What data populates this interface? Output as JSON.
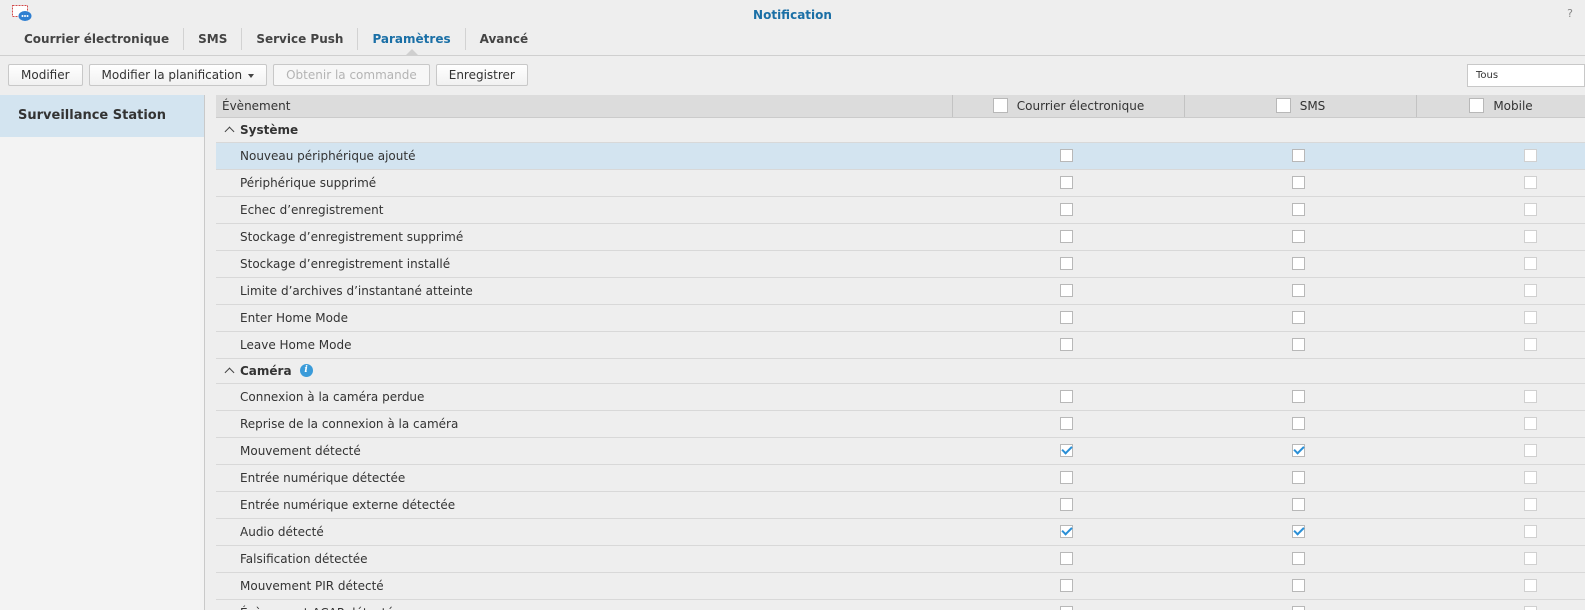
{
  "window": {
    "title": "Notification",
    "help": "?"
  },
  "tabs": [
    {
      "label": "Courrier électronique",
      "active": false
    },
    {
      "label": "SMS",
      "active": false
    },
    {
      "label": "Service Push",
      "active": false
    },
    {
      "label": "Paramètres",
      "active": true
    },
    {
      "label": "Avancé",
      "active": false
    }
  ],
  "toolbar": {
    "edit": "Modifier",
    "edit_schedule": "Modifier la planification",
    "get_command": "Obtenir la commande",
    "save": "Enregistrer"
  },
  "filter": {
    "value": "Tous"
  },
  "sidebar": {
    "items": [
      {
        "label": "Surveillance Station"
      }
    ]
  },
  "grid": {
    "columns": {
      "event": "Évènement",
      "email": "Courrier électronique",
      "sms": "SMS",
      "mobile": "Mobile"
    },
    "groups": [
      {
        "label": "Système",
        "info": false,
        "rows": [
          {
            "label": "Nouveau périphérique ajouté",
            "email": false,
            "sms": false,
            "mobile": false
          },
          {
            "label": "Périphérique supprimé",
            "email": false,
            "sms": false,
            "mobile": false
          },
          {
            "label": "Echec d’enregistrement",
            "email": false,
            "sms": false,
            "mobile": false
          },
          {
            "label": "Stockage d’enregistrement supprimé",
            "email": false,
            "sms": false,
            "mobile": false
          },
          {
            "label": "Stockage d’enregistrement installé",
            "email": false,
            "sms": false,
            "mobile": false
          },
          {
            "label": "Limite d’archives d’instantané atteinte",
            "email": false,
            "sms": false,
            "mobile": false
          },
          {
            "label": "Enter Home Mode",
            "email": false,
            "sms": false,
            "mobile": false
          },
          {
            "label": "Leave Home Mode",
            "email": false,
            "sms": false,
            "mobile": false
          }
        ]
      },
      {
        "label": "Caméra",
        "info": true,
        "rows": [
          {
            "label": "Connexion à la caméra perdue",
            "email": false,
            "sms": false,
            "mobile": false
          },
          {
            "label": "Reprise de la connexion à la caméra",
            "email": false,
            "sms": false,
            "mobile": false
          },
          {
            "label": "Mouvement détecté",
            "email": true,
            "sms": true,
            "mobile": false
          },
          {
            "label": "Entrée numérique détectée",
            "email": false,
            "sms": false,
            "mobile": false
          },
          {
            "label": "Entrée numérique externe détectée",
            "email": false,
            "sms": false,
            "mobile": false
          },
          {
            "label": "Audio détecté",
            "email": true,
            "sms": true,
            "mobile": false
          },
          {
            "label": "Falsification détectée",
            "email": false,
            "sms": false,
            "mobile": false
          },
          {
            "label": "Mouvement PIR détecté",
            "email": false,
            "sms": false,
            "mobile": false
          },
          {
            "label": "Évènement ACAP détecté",
            "email": false,
            "sms": false,
            "mobile": false
          }
        ]
      }
    ]
  }
}
